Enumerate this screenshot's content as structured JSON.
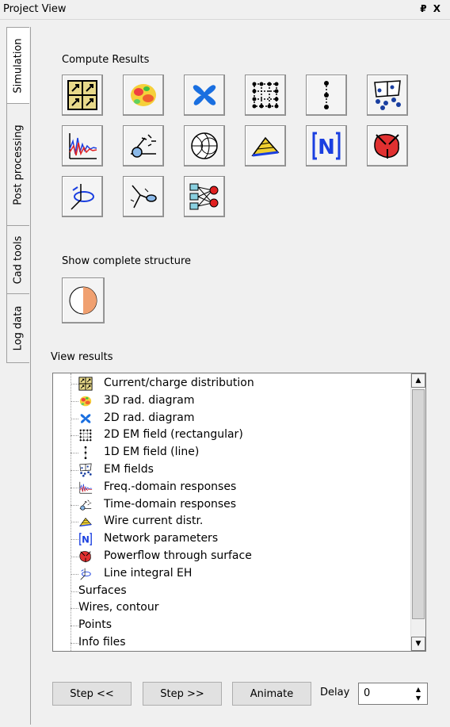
{
  "window": {
    "title": "Project View",
    "controls": "₽ X"
  },
  "tabs": [
    {
      "label": "Simulation"
    },
    {
      "label": "Post processing"
    },
    {
      "label": "Cad tools"
    },
    {
      "label": "Log data"
    }
  ],
  "compute": {
    "label": "Compute Results",
    "buttons": [
      {
        "icon": "current-distribution-icon"
      },
      {
        "icon": "3d-rad-diagram-icon"
      },
      {
        "icon": "2d-rad-diagram-icon"
      },
      {
        "icon": "2d-em-field-icon"
      },
      {
        "icon": "1d-em-field-icon"
      },
      {
        "icon": "em-fields-icon"
      },
      {
        "icon": "freq-domain-icon"
      },
      {
        "icon": "time-domain-icon"
      },
      {
        "icon": "smith-chart-icon"
      },
      {
        "icon": "wire-current-icon"
      },
      {
        "icon": "network-parameters-icon"
      },
      {
        "icon": "powerflow-icon"
      },
      {
        "icon": "line-integral-icon"
      },
      {
        "icon": "antenna-coupling-icon"
      },
      {
        "icon": "network-graph-icon"
      }
    ]
  },
  "structure": {
    "label": "Show complete structure"
  },
  "view_results": {
    "label": "View results",
    "items": [
      {
        "label": "Current/charge distribution",
        "icon": "current-distribution-icon"
      },
      {
        "label": "3D rad. diagram",
        "icon": "3d-rad-diagram-icon"
      },
      {
        "label": "2D rad. diagram",
        "icon": "2d-rad-diagram-icon"
      },
      {
        "label": "2D EM field (rectangular)",
        "icon": "2d-em-field-icon"
      },
      {
        "label": "1D EM field (line)",
        "icon": "1d-em-field-icon"
      },
      {
        "label": "EM fields",
        "icon": "em-fields-icon"
      },
      {
        "label": "Freq.-domain responses",
        "icon": "freq-domain-icon"
      },
      {
        "label": "Time-domain responses",
        "icon": "time-domain-icon"
      },
      {
        "label": "Wire current distr.",
        "icon": "wire-current-icon"
      },
      {
        "label": "Network parameters",
        "icon": "network-parameters-icon"
      },
      {
        "label": "Powerflow through surface",
        "icon": "powerflow-icon"
      },
      {
        "label": "Line integral EH",
        "icon": "line-integral-icon"
      },
      {
        "label": "Surfaces",
        "icon": ""
      },
      {
        "label": "Wires, contour",
        "icon": ""
      },
      {
        "label": "Points",
        "icon": ""
      },
      {
        "label": "Info files",
        "icon": ""
      }
    ]
  },
  "playback": {
    "step_back": "Step <<",
    "step_forward": "Step >>",
    "animate": "Animate",
    "delay_label": "Delay",
    "delay_value": "0"
  }
}
